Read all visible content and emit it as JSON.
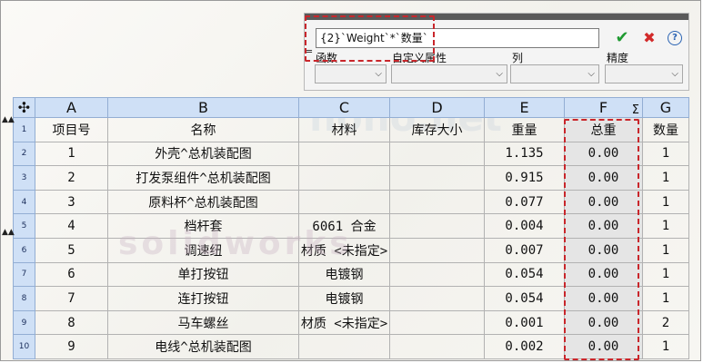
{
  "formula_panel": {
    "equals": "=",
    "expression": "{2}`Weight`*`数量`",
    "ok_icon": "✔",
    "cancel_icon": "✖",
    "help_icon": "?",
    "labels": [
      "函数",
      "自定义属性",
      "列",
      "精度"
    ],
    "highlight_color": "#c9262b"
  },
  "table": {
    "corner_icon": "✣",
    "columns": [
      "A",
      "B",
      "C",
      "D",
      "E",
      "F",
      "G"
    ],
    "f_sigma": "Σ",
    "rows": [
      {
        "num": "1",
        "cells": [
          "项目号",
          "名称",
          "材料",
          "库存大小",
          "重量",
          "总重",
          "数量"
        ]
      },
      {
        "num": "2",
        "cells": [
          "1",
          "外壳^总机装配图",
          "",
          "",
          "1.135",
          "0.00",
          "1"
        ]
      },
      {
        "num": "3",
        "cells": [
          "2",
          "打发泵组件^总机装配图",
          "",
          "",
          "0.915",
          "0.00",
          "1"
        ]
      },
      {
        "num": "4",
        "cells": [
          "3",
          "原料杯^总机装配图",
          "",
          "",
          "0.077",
          "0.00",
          "1"
        ]
      },
      {
        "num": "5",
        "cells": [
          "4",
          "档杆套",
          "6061 合金",
          "",
          "0.004",
          "0.00",
          "1"
        ]
      },
      {
        "num": "6",
        "cells": [
          "5",
          "调速纽",
          "材质 <未指定>",
          "",
          "0.007",
          "0.00",
          "1"
        ]
      },
      {
        "num": "7",
        "cells": [
          "6",
          "单打按钮",
          "电镀钢",
          "",
          "0.054",
          "0.00",
          "1"
        ]
      },
      {
        "num": "8",
        "cells": [
          "7",
          "连打按钮",
          "电镀钢",
          "",
          "0.054",
          "0.00",
          "1"
        ]
      },
      {
        "num": "9",
        "cells": [
          "8",
          "马车螺丝",
          "材质 <未指定>",
          "",
          "0.001",
          "0.00",
          "2"
        ]
      },
      {
        "num": "10",
        "cells": [
          "9",
          "电线^总机装配图",
          "",
          "",
          "0.002",
          "0.00",
          "1"
        ]
      }
    ]
  },
  "colors": {
    "header_bg": "#cfe0f6",
    "selected_column_bg": "#e5e5e5",
    "ok_green": "#1f9a31",
    "cancel_red": "#d22a2a"
  }
}
